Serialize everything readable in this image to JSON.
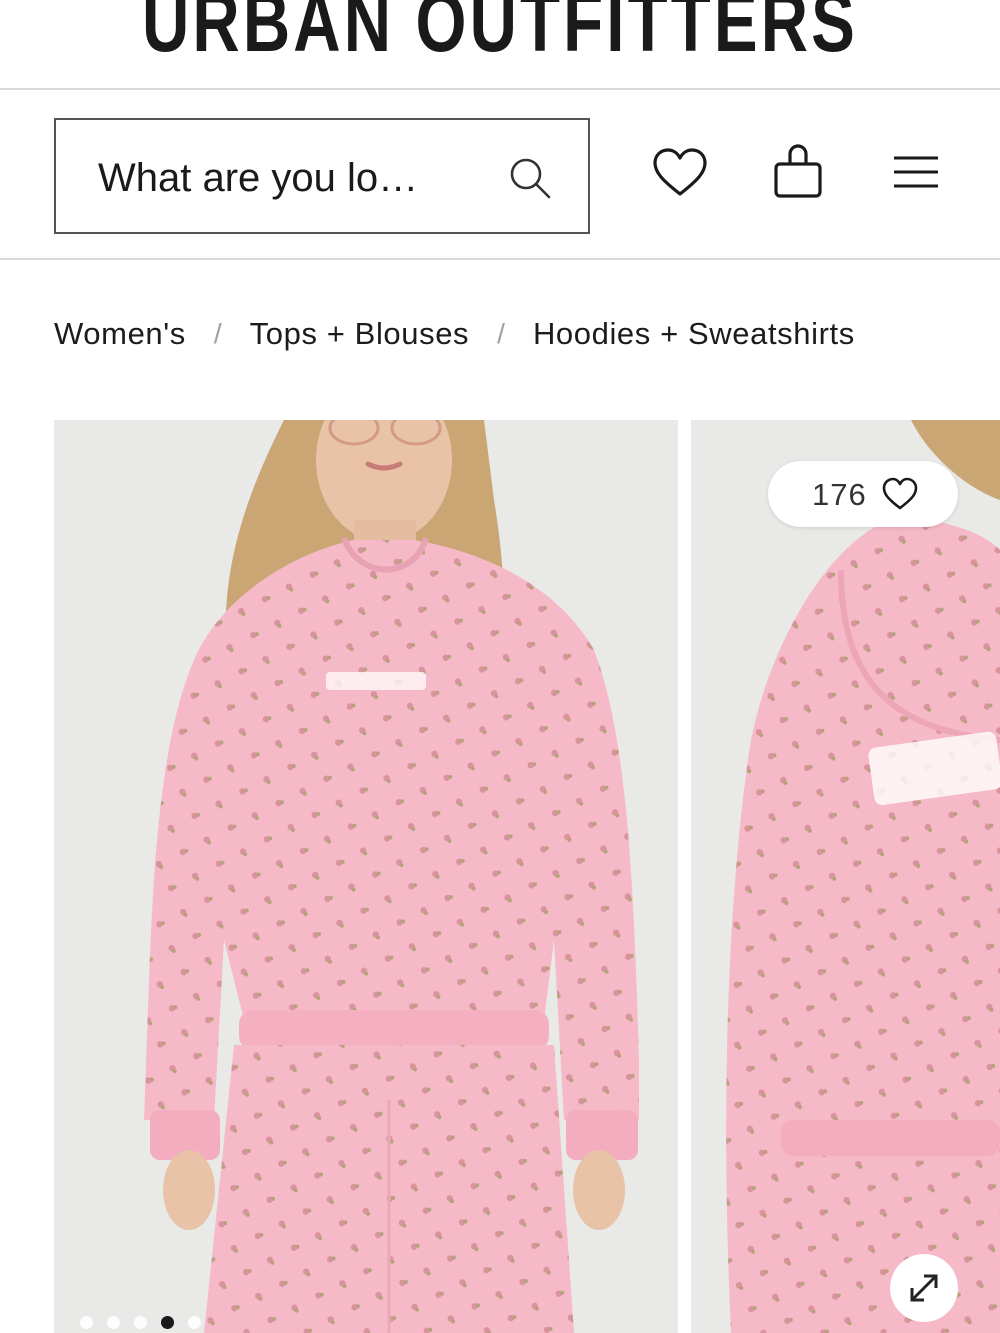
{
  "brand": {
    "logo_text": "URBAN OUTFITTERS"
  },
  "header": {
    "search": {
      "value": "What are you lo…",
      "icon": "search-icon"
    },
    "icons": {
      "wishlist": "heart-icon",
      "bag": "shopping-bag-icon",
      "menu": "hamburger-menu-icon"
    }
  },
  "breadcrumb": {
    "items": [
      "Women's",
      "Tops + Blouses",
      "Hoodies + Sweatshirts"
    ],
    "separator": "/"
  },
  "gallery": {
    "like_count": "176",
    "like_icon": "heart-outline-icon",
    "expand_icon": "expand-icon",
    "image_count": 5,
    "active_index": 3,
    "colors": {
      "hoodie_pink": "#f6b9c8",
      "background": "#e9e9e7",
      "hair": "#c9a673"
    }
  }
}
